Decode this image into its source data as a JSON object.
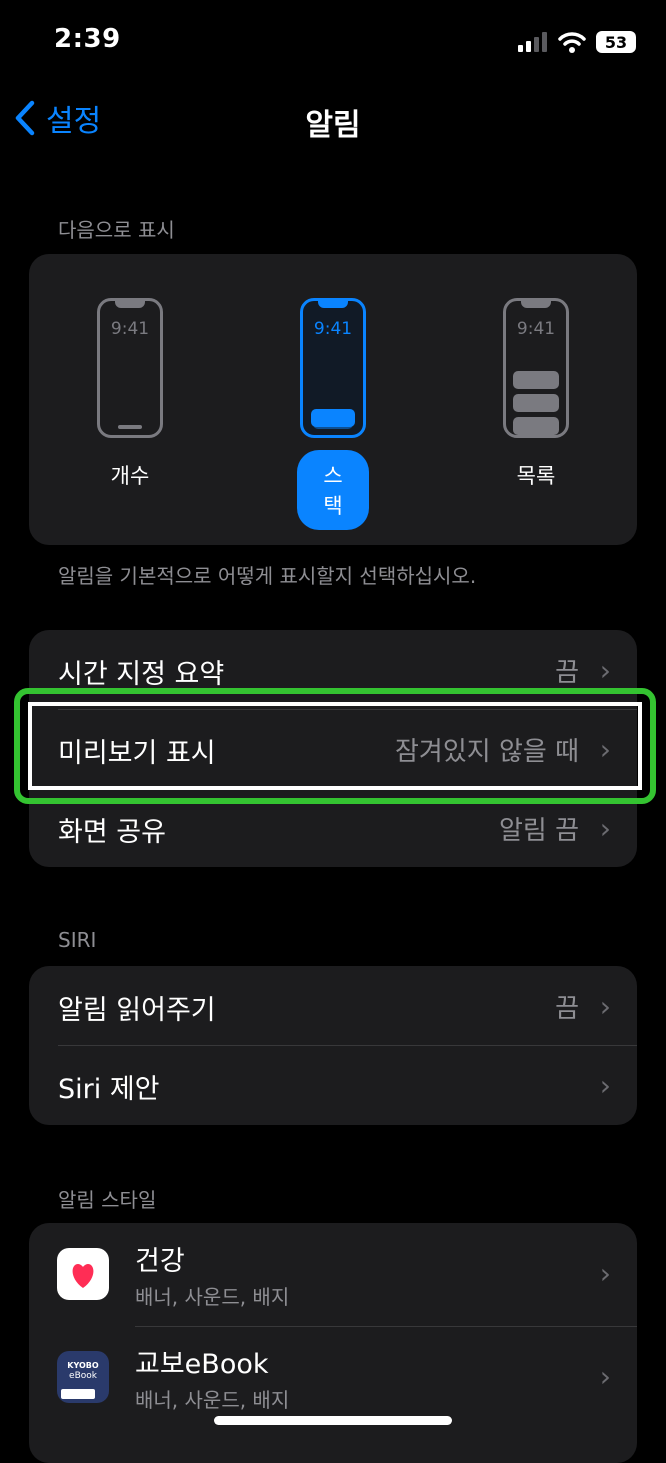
{
  "status": {
    "time": "2:39",
    "battery": "53"
  },
  "nav": {
    "back_label": "설정",
    "title": "알림"
  },
  "display_section": {
    "header": "다음으로 표시",
    "options": [
      {
        "label": "개수",
        "time": "9:41"
      },
      {
        "label": "스택",
        "time": "9:41",
        "selected": true
      },
      {
        "label": "목록",
        "time": "9:41"
      }
    ],
    "footer": "알림을 기본적으로 어떻게 표시할지 선택하십시오."
  },
  "settings": [
    {
      "label": "시간 지정 요약",
      "value": "끔"
    },
    {
      "label": "미리보기 표시",
      "value": "잠겨있지 않을 때"
    },
    {
      "label": "화면 공유",
      "value": "알림 끔"
    }
  ],
  "siri_section": {
    "header": "SIRI",
    "rows": [
      {
        "label": "알림 읽어주기",
        "value": "끔"
      },
      {
        "label": "Siri 제안",
        "value": ""
      }
    ]
  },
  "style_section": {
    "header": "알림 스타일",
    "apps": [
      {
        "name": "건강",
        "subtitle": "배너, 사운드, 배지",
        "icon": "health-icon"
      },
      {
        "name": "교보eBook",
        "subtitle": "배너, 사운드, 배지",
        "icon": "kyobo-ebook-icon",
        "icon_text_top": "KYOBO",
        "icon_text_bottom": "eBook"
      }
    ]
  },
  "colors": {
    "accent": "#0a84ff",
    "highlight": "#34c331",
    "card": "#1c1c1e"
  }
}
